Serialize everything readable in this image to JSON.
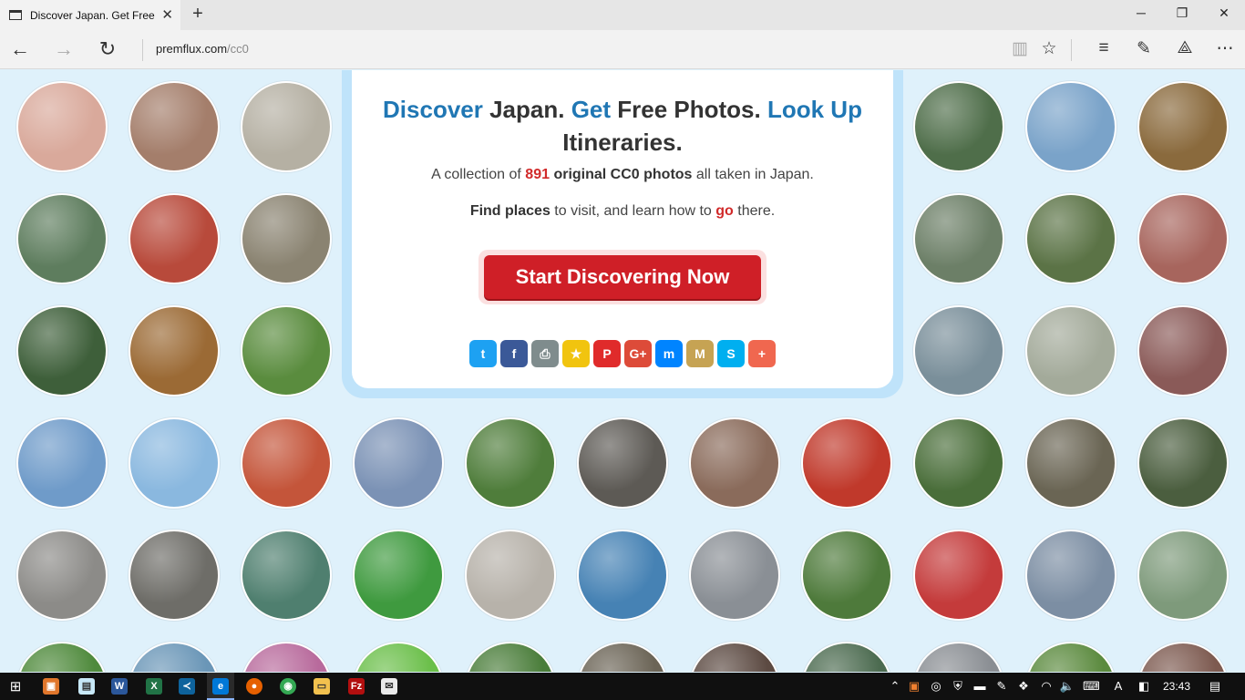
{
  "browser": {
    "tab_title": "Discover Japan. Get Free",
    "url_domain": "premflux.com",
    "url_path": "/cc0"
  },
  "hero": {
    "title_parts": [
      "Discover",
      " Japan. ",
      "Get",
      " Free Photos. ",
      "Look Up",
      " Itineraries."
    ],
    "line1_prefix": "A collection of ",
    "photo_count": "891",
    "line1_bold": " original CC0 photos",
    "line1_suffix": " all taken in Japan.",
    "line2_bold": "Find places",
    "line2_middle": " to visit, and learn how to ",
    "line2_red": "go",
    "line2_suffix": " there.",
    "cta_label": "Start Discovering Now"
  },
  "share_buttons": [
    {
      "name": "twitter",
      "glyph": "t",
      "color": "#1da1f2"
    },
    {
      "name": "facebook",
      "glyph": "f",
      "color": "#3b5998"
    },
    {
      "name": "print",
      "glyph": "⎙",
      "color": "#7f8c8d"
    },
    {
      "name": "bookmark",
      "glyph": "★",
      "color": "#f1c40f"
    },
    {
      "name": "pinterest",
      "glyph": "P",
      "color": "#e02b2b"
    },
    {
      "name": "google-plus",
      "glyph": "G+",
      "color": "#dd4b39"
    },
    {
      "name": "messenger",
      "glyph": "m",
      "color": "#0084ff"
    },
    {
      "name": "mastodon",
      "glyph": "M",
      "color": "#c6a353"
    },
    {
      "name": "skype",
      "glyph": "S",
      "color": "#00aff0"
    },
    {
      "name": "more",
      "glyph": "+",
      "color": "#f0674f"
    }
  ],
  "photo_rows": [
    [
      "#d9a99b",
      "#a47e6b",
      "#b5b0a3",
      "",
      "",
      "",
      "",
      "",
      "#4f6e4a",
      "#7aa3c9",
      "#8a6a3d"
    ],
    [
      "#5e7d5e",
      "#b84a3b",
      "#8a8371",
      "",
      "",
      "",
      "",
      "",
      "#6c7f67",
      "#5b7346",
      "#a7655d"
    ],
    [
      "#3e5f3a",
      "#9b6a35",
      "#5a8c3e",
      "#3c4e6b",
      "#4d6b8a",
      "#7a9a88",
      "#8b8e93",
      "#6a7d86",
      "#7a8f9a",
      "#a3aa9a",
      "#8a5a58"
    ],
    [
      "#6f9bc9",
      "#8ab8df",
      "#c4553a",
      "#7b92b5",
      "#4f7d3b",
      "#5d5a55",
      "#8a6b5b",
      "#c0392b",
      "#4a6e3a",
      "#6a6554",
      "#4b5e3f"
    ],
    [
      "#8c8b88",
      "#6e6d68",
      "#4f7f6f",
      "#3f9a3f",
      "#b7b2aa",
      "#4682b4",
      "#8a8f95",
      "#4e7a3b",
      "#c43b3b",
      "#7c8ea3",
      "#7e9a7b"
    ],
    [
      "#4f8a3c",
      "#6a96b7",
      "#b86a9c",
      "#6bbf4a",
      "#4a7d3a",
      "#6b6456",
      "#5c4a42",
      "#4c6b50",
      "#8a8e93",
      "#5b8a3e",
      "#7d5a50"
    ]
  ],
  "clock": "23:43"
}
